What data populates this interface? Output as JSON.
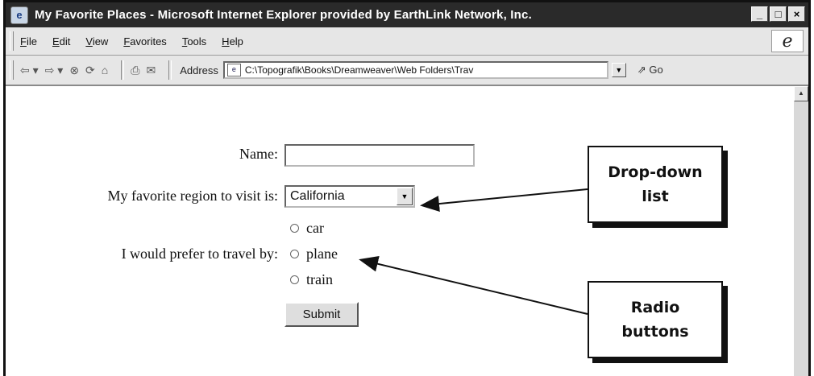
{
  "window": {
    "title": "My Favorite Places - Microsoft Internet Explorer provided by EarthLink Network, Inc.",
    "controls": [
      "minimize-icon",
      "maximize-icon",
      "close-icon"
    ]
  },
  "menu": {
    "items": [
      {
        "label": "File"
      },
      {
        "label": "Edit"
      },
      {
        "label": "View"
      },
      {
        "label": "Favorites"
      },
      {
        "label": "Tools"
      },
      {
        "label": "Help"
      }
    ]
  },
  "toolbar": {
    "address_label": "Address",
    "address_value": "C:\\Topografik\\Books\\Dreamweaver\\Web Folders\\Trav",
    "go_label": "Go"
  },
  "form": {
    "name_label": "Name:",
    "name_value": "",
    "region_label": "My favorite region to visit is:",
    "region_selected": "California",
    "travel_label": "I would prefer to travel by:",
    "travel_options": [
      {
        "label": "car"
      },
      {
        "label": "plane"
      },
      {
        "label": "train"
      }
    ],
    "submit_label": "Submit"
  },
  "callouts": {
    "dropdown_line1": "Drop-down",
    "dropdown_line2": "list",
    "radio_line1": "Radio",
    "radio_line2": "buttons"
  }
}
